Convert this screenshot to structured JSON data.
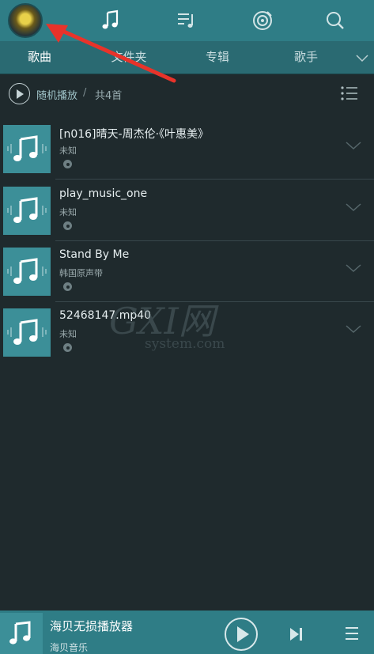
{
  "header": {
    "avatar_icon": "user-avatar",
    "icons": [
      "music-note-icon",
      "playlist-icon",
      "radio-icon",
      "search-icon"
    ]
  },
  "tabs": [
    {
      "label": "歌曲",
      "active": true
    },
    {
      "label": "文件夹",
      "active": false
    },
    {
      "label": "专辑",
      "active": false
    },
    {
      "label": "歌手",
      "active": false
    }
  ],
  "shuffle": {
    "label": "随机播放",
    "separator": "/",
    "count": "共4首"
  },
  "songs": [
    {
      "title": "[n016]晴天-周杰伦·《叶惠美》",
      "artist": "未知"
    },
    {
      "title": "play_music_one",
      "artist": "未知"
    },
    {
      "title": "Stand By Me",
      "artist": "韩国原声带"
    },
    {
      "title": "52468147.mp40",
      "artist": "未知"
    }
  ],
  "watermark": {
    "big": "GXI网",
    "small": "system.com"
  },
  "player": {
    "title": "海贝无损播放器",
    "subtitle": "海贝音乐"
  },
  "colors": {
    "topbar": "#2f7d86",
    "tabs": "#2a6a72",
    "background": "#1f2a2d",
    "thumb": "#3c8f98",
    "annotation_arrow": "#e8332a"
  }
}
